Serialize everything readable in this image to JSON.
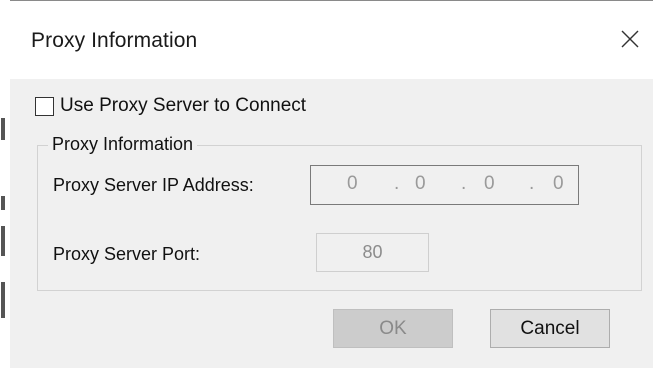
{
  "dialog": {
    "title": "Proxy Information",
    "close_icon": "close-icon"
  },
  "use_proxy": {
    "label": "Use Proxy Server to Connect",
    "checked": false
  },
  "group": {
    "title": "Proxy Information",
    "ip_label": "Proxy Server IP Address:",
    "ip_octets": [
      "0",
      "0",
      "0",
      "0"
    ],
    "ip_separator": ".",
    "port_label": "Proxy Server Port:",
    "port_value": "80"
  },
  "buttons": {
    "ok_label": "OK",
    "cancel_label": "Cancel"
  },
  "colors": {
    "dialog_bg": "#f0f0f0",
    "titlebar_bg": "#ffffff",
    "disabled_text": "#8a8a8a"
  }
}
